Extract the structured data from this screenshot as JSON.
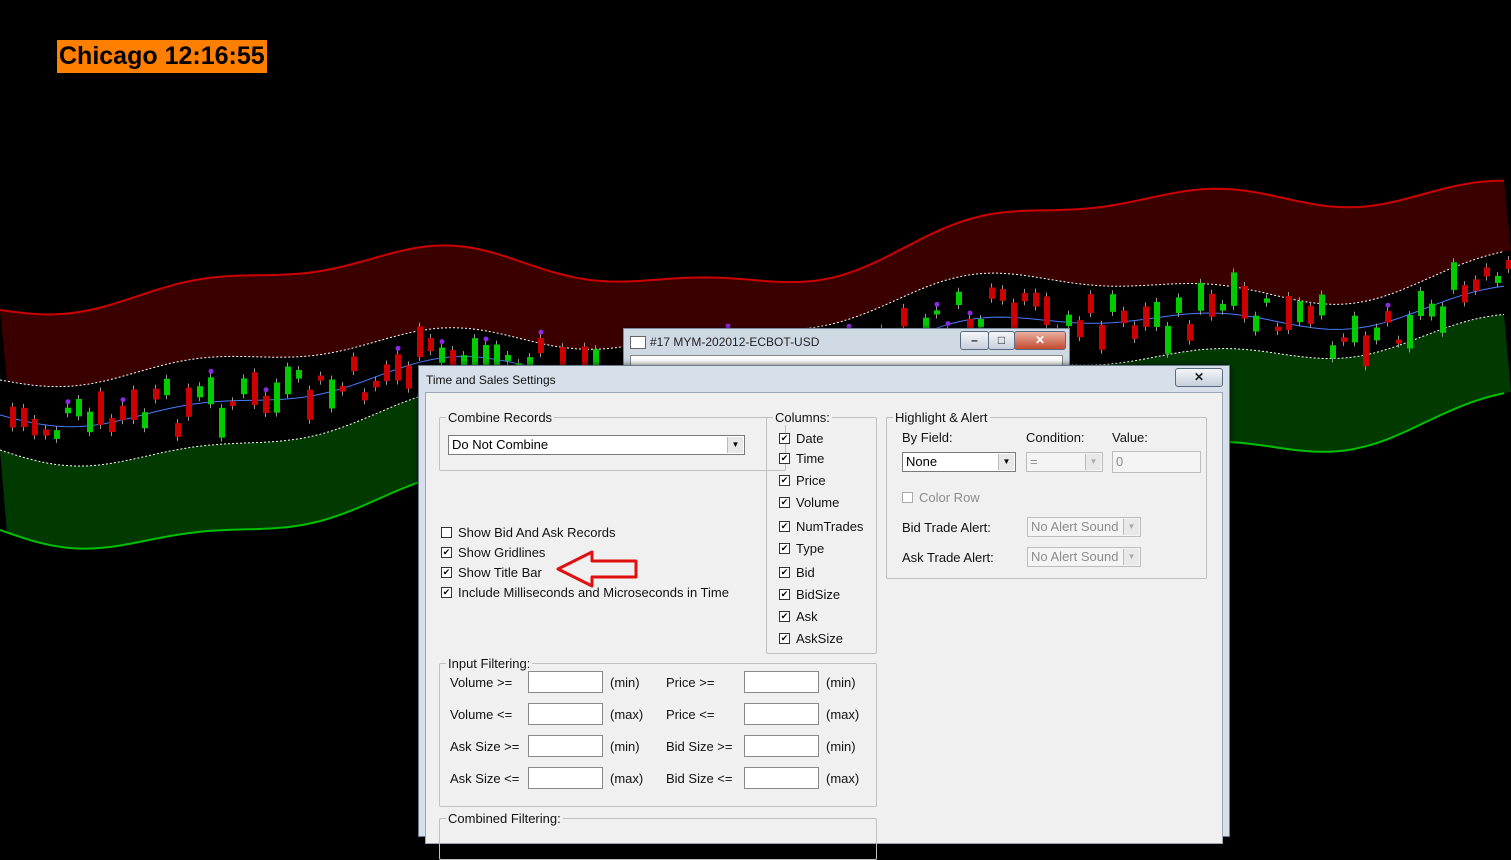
{
  "clock": {
    "text": "Chicago 12:16:55",
    "bg": "#ff7f00"
  },
  "chart_data": {
    "colors": {
      "upper_band": "#cc0000",
      "lower_band": "#00c000",
      "mid_line": "#4a7aff",
      "up_candle": "#00cc00",
      "down_candle": "#cc0000",
      "marker": "#8a2be2"
    }
  },
  "back_window": {
    "title": "#17 MYM-202012-ECBOT-USD",
    "icon": "window-icon"
  },
  "dialog": {
    "title": "Time and Sales Settings",
    "close_glyph": "✕",
    "combine_records": {
      "label": "Combine Records",
      "selected": "Do Not Combine"
    },
    "options": [
      {
        "label": "Show Bid And Ask Records",
        "checked": false
      },
      {
        "label": "Show Gridlines",
        "checked": true
      },
      {
        "label": "Show Title Bar",
        "checked": true
      },
      {
        "label": "Include Milliseconds and Microseconds in Time",
        "checked": true
      }
    ],
    "columns": {
      "label": "Columns:",
      "items": [
        {
          "label": "Date",
          "checked": true
        },
        {
          "label": "Time",
          "checked": true
        },
        {
          "label": "Price",
          "checked": true
        },
        {
          "label": "Volume",
          "checked": true
        },
        {
          "label": "NumTrades",
          "checked": true
        },
        {
          "label": "Type",
          "checked": true
        },
        {
          "label": "Bid",
          "checked": true
        },
        {
          "label": "BidSize",
          "checked": true
        },
        {
          "label": "Ask",
          "checked": true
        },
        {
          "label": "AskSize",
          "checked": true
        }
      ]
    },
    "highlight": {
      "label": "Highlight & Alert",
      "by_field_label": "By Field:",
      "by_field_value": "None",
      "condition_label": "Condition:",
      "condition_value": "=",
      "value_label": "Value:",
      "value_value": "0",
      "color_row_label": "Color Row",
      "bid_alert_label": "Bid Trade Alert:",
      "bid_alert_value": "No Alert Sound",
      "ask_alert_label": "Ask Trade Alert:",
      "ask_alert_value": "No Alert Sound"
    },
    "input_filtering": {
      "label": "Input Filtering:",
      "rows": [
        {
          "left_label": "Volume >=",
          "left_unit": "(min)",
          "right_label": "Price >=",
          "right_unit": "(min)"
        },
        {
          "left_label": "Volume <=",
          "left_unit": "(max)",
          "right_label": "Price <=",
          "right_unit": "(max)"
        },
        {
          "left_label": "Ask Size >=",
          "left_unit": "(min)",
          "right_label": "Bid Size >=",
          "right_unit": "(min)"
        },
        {
          "left_label": "Ask Size <=",
          "left_unit": "(max)",
          "right_label": "Bid Size <=",
          "right_unit": "(max)"
        }
      ]
    },
    "combined_filtering": {
      "label": "Combined Filtering:"
    }
  }
}
